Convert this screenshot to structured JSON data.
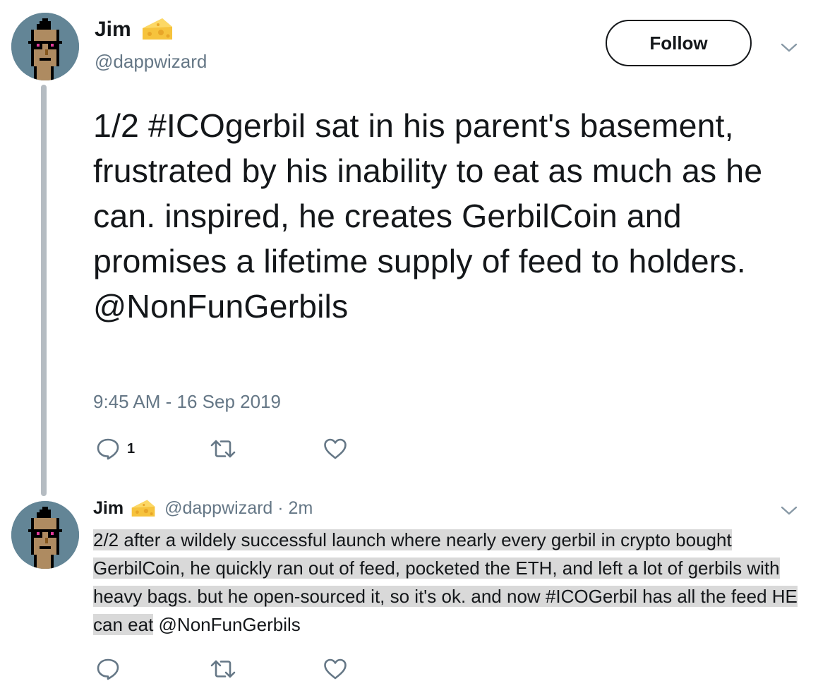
{
  "main_tweet": {
    "author_name": "Jim",
    "author_handle": "@dappwizard",
    "follow_label": "Follow",
    "text": "1/2 #ICOgerbil sat in his parent's basement, frustrated by his inability to eat as much as he can. inspired, he creates GerbilCoin and promises a lifetime supply of feed to holders. @NonFunGerbils",
    "timestamp": "9:45 AM - 16 Sep 2019",
    "reply_count": "1",
    "icons": [
      "cheese-icon",
      "chevron-down-icon",
      "reply-icon",
      "retweet-icon",
      "like-icon"
    ]
  },
  "reply_tweet": {
    "author_name": "Jim",
    "meta": "@dappwizard · 2m",
    "text_highlighted": "2/2 after a wildely successful launch where nearly every gerbil in crypto bought GerbilCoin, he quickly ran out of feed, pocketed the ETH, and left a lot of gerbils with heavy bags.  but he open-sourced it, so it's ok. and now #ICOGerbil has all the feed HE can eat",
    "mention": " @NonFunGerbils"
  },
  "colors": {
    "text": "#14171a",
    "secondary": "#657786",
    "thread_line": "#b5bcc2",
    "highlight": "#d9d9d9",
    "avatar_bg": "#638596"
  }
}
